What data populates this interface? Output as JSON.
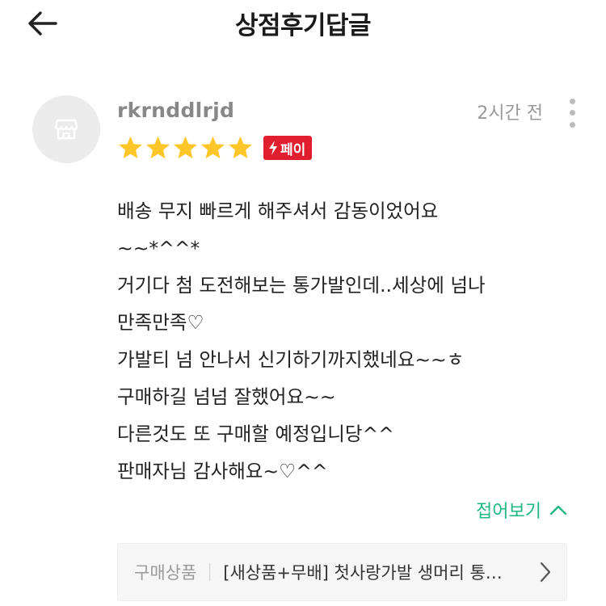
{
  "header": {
    "title": "상점후기답글"
  },
  "review": {
    "username": "rkrnddlrjd",
    "time": "2시간 전",
    "rating": 5,
    "rating_max": 5,
    "star_color": "#ffc629",
    "pay_badge": "페이",
    "pay_badge_color": "#e01e2d",
    "lines": [
      "배송 무지 빠르게 해주셔서 감동이었어요",
      "~~*^^*",
      "거기다 첨 도전해보는 통가발인데..세상에 넘나",
      "만족만족♡",
      "가발티 넘 안나서 신기하기까지했네요~~ㅎ",
      "구매하길 넘넘 잘했어요~~",
      "다른것도 또 구매할 예정입니당^^",
      "판매자님 감사해요~♡^^"
    ],
    "fold_label": "접어보기",
    "accent_color": "#1db980"
  },
  "product": {
    "label": "구매상품",
    "name": "[새상품+무배] 첫사랑가발 생머리 통가발"
  },
  "icons": {
    "back": "arrow-left-icon",
    "avatar": "shop-icon",
    "more": "more-vertical-icon",
    "pay": "lightning-icon",
    "fold": "chevron-up-icon",
    "product": "chevron-right-icon"
  }
}
